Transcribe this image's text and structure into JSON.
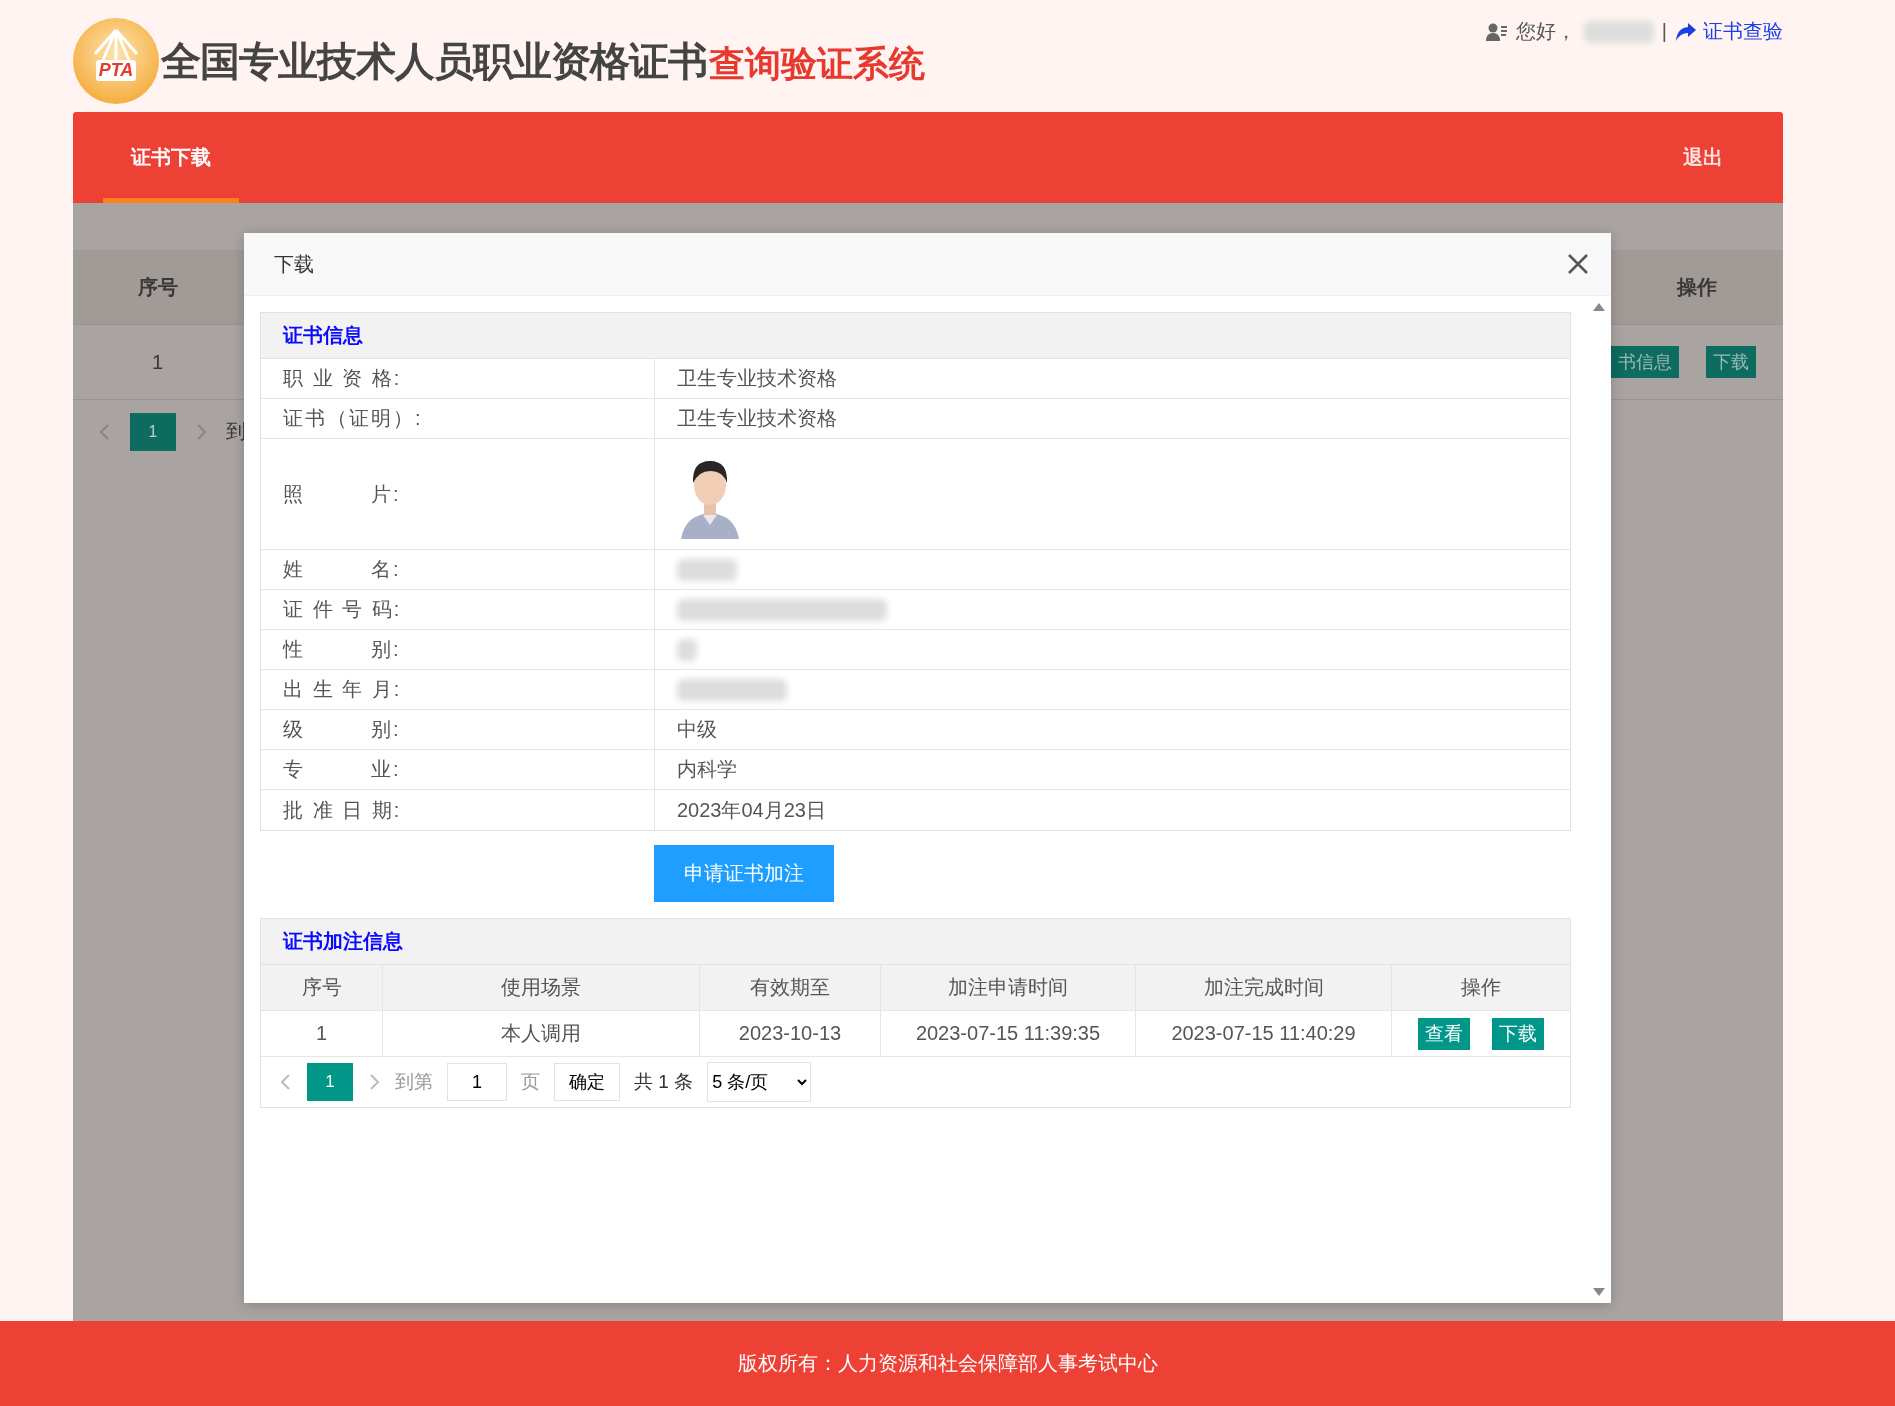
{
  "header": {
    "logo_text": "PTA",
    "title_main": "全国专业技术人员职业资格证书",
    "title_accent": "查询验证系统",
    "greeting": "您好，",
    "separator": "|",
    "verify_link": "证书查验"
  },
  "nav": {
    "tabs": [
      {
        "label": "证书下载",
        "selected": true
      }
    ],
    "logout": "退出"
  },
  "background_table": {
    "columns": [
      "序号",
      "操作"
    ],
    "row": {
      "index": "1",
      "actions": [
        "书信息",
        "下载"
      ]
    },
    "pagination": {
      "page": "1",
      "goto": "到"
    }
  },
  "dialog": {
    "title": "下载",
    "info": {
      "heading": "证书信息",
      "rows": [
        {
          "kind": "text",
          "label": "职 业 资 格:",
          "value": "卫生专业技术资格"
        },
        {
          "kind": "text",
          "label": "证书（证明）:",
          "value": "卫生专业技术资格"
        },
        {
          "label": "照　　　片:"
        },
        {
          "kind": "redacted",
          "label": "姓　　　名:"
        },
        {
          "kind": "redacted",
          "label": "证 件 号 码:"
        },
        {
          "kind": "redacted",
          "label": "性　　　别:"
        },
        {
          "kind": "redacted",
          "label": "出 生 年 月:"
        },
        {
          "kind": "text",
          "label": "级　　　别:",
          "value": "中级"
        },
        {
          "kind": "text",
          "label": "专　　　业:",
          "value": "内科学"
        },
        {
          "kind": "text",
          "label": "批 准 日 期:",
          "value": "2023年04月23日"
        }
      ]
    },
    "apply_button": "申请证书加注",
    "annotations": {
      "heading": "证书加注信息",
      "columns": [
        "序号",
        "使用场景",
        "有效期至",
        "加注申请时间",
        "加注完成时间",
        "操作"
      ],
      "rows": [
        {
          "cells": [
            "1",
            "本人调用",
            "2023-10-13",
            "2023-07-15 11:39:35",
            "2023-07-15 11:40:29"
          ],
          "actions": [
            "查看",
            "下载"
          ]
        }
      ],
      "pagination": {
        "pages": [
          {
            "label": "1",
            "selected": true
          }
        ],
        "goto_label": "到第",
        "goto_value": "1",
        "page_unit": "页",
        "confirm": "确定",
        "total": "共 1 条",
        "page_size": "5 条/页"
      }
    }
  },
  "footer": "版权所有：人力资源和社会保障部人事考试中心"
}
